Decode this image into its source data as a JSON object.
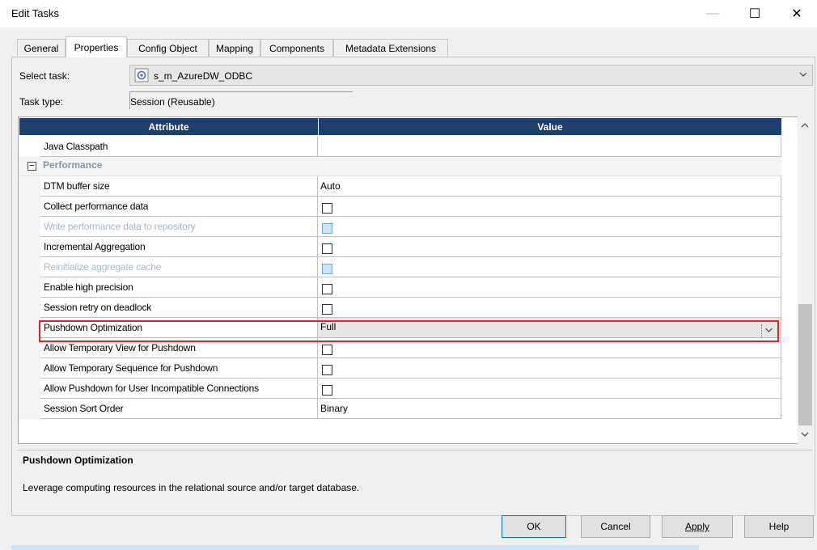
{
  "window": {
    "title": "Edit Tasks",
    "minimize": "—",
    "maximize": "☐",
    "close": "✕"
  },
  "tabs": [
    {
      "label": "General"
    },
    {
      "label": "Properties"
    },
    {
      "label": "Config Object"
    },
    {
      "label": "Mapping"
    },
    {
      "label": "Components"
    },
    {
      "label": "Metadata Extensions"
    }
  ],
  "select_task": {
    "label": "Select task:",
    "value": "s_m_AzureDW_ODBC"
  },
  "task_type": {
    "label": "Task type:",
    "value": "Session (Reusable)"
  },
  "grid": {
    "headers": {
      "attribute": "Attribute",
      "value": "Value"
    },
    "top_row": {
      "attribute": "Java Classpath",
      "value": ""
    },
    "group": "Performance",
    "rows": [
      {
        "attribute": "DTM buffer size",
        "value": "Auto",
        "type": "text",
        "disabled": false
      },
      {
        "attribute": "Collect performance data",
        "value": "",
        "type": "checkbox",
        "disabled": false
      },
      {
        "attribute": "Write performance data to repository",
        "value": "",
        "type": "checkbox",
        "disabled": true
      },
      {
        "attribute": "Incremental Aggregation",
        "value": "",
        "type": "checkbox",
        "disabled": false
      },
      {
        "attribute": "Reinitialize aggregate cache",
        "value": "",
        "type": "checkbox",
        "disabled": true
      },
      {
        "attribute": "Enable high precision",
        "value": "",
        "type": "checkbox",
        "disabled": false
      },
      {
        "attribute": "Session retry on deadlock",
        "value": "",
        "type": "checkbox",
        "disabled": false
      },
      {
        "attribute": "Pushdown Optimization",
        "value": "Full",
        "type": "dropdown",
        "disabled": false
      },
      {
        "attribute": "Allow Temporary View for Pushdown",
        "value": "",
        "type": "checkbox",
        "disabled": false
      },
      {
        "attribute": "Allow Temporary Sequence for Pushdown",
        "value": "",
        "type": "checkbox",
        "disabled": false
      },
      {
        "attribute": "Allow Pushdown for User Incompatible Connections",
        "value": "",
        "type": "checkbox",
        "disabled": false
      },
      {
        "attribute": "Session Sort Order",
        "value": "Binary",
        "type": "text",
        "disabled": false
      }
    ]
  },
  "description": {
    "title": "Pushdown Optimization",
    "text": "Leverage computing resources in the relational source and/or target database."
  },
  "buttons": {
    "ok": "OK",
    "cancel": "Cancel",
    "apply": "Apply",
    "help": "Help"
  },
  "colors": {
    "header": "#1f3e6e",
    "highlight": "#e3222a"
  }
}
